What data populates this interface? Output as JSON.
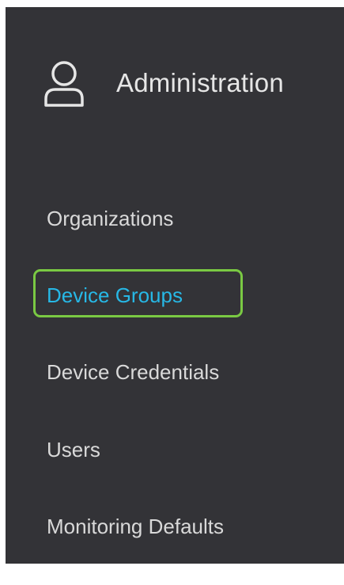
{
  "header": {
    "title": "Administration",
    "icon": "user-icon"
  },
  "nav": {
    "items": [
      {
        "label": "Organizations",
        "active": false
      },
      {
        "label": "Device Groups",
        "active": true
      },
      {
        "label": "Device Credentials",
        "active": false
      },
      {
        "label": "Users",
        "active": false
      },
      {
        "label": "Monitoring Defaults",
        "active": false
      }
    ]
  },
  "colors": {
    "panel_background": "#333337",
    "text": "#d9d9d9",
    "active_text": "#27b8e6",
    "focus_ring": "#7ac943"
  }
}
